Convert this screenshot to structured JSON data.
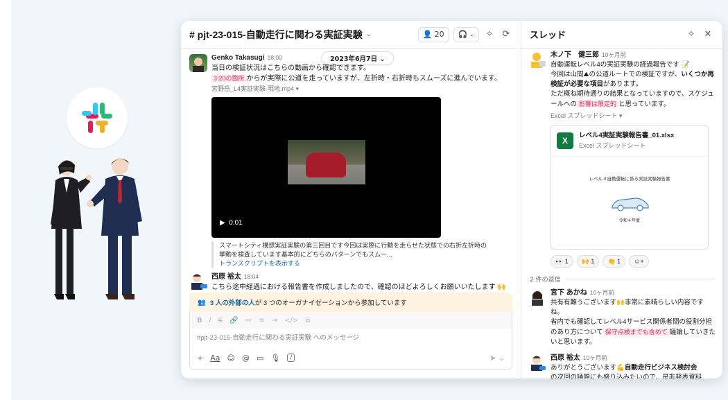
{
  "channel": {
    "title": "# pjt-23-015-自動走行に関わる実証実験",
    "member_count": "20",
    "date_pill": "2023年6月7日",
    "messages": [
      {
        "author": "Genko Takasugi",
        "time": "18:00",
        "line1": "当日の検証状況はこちらの動画から確認できます。",
        "timestamp_tag": "3:20の箇所",
        "line2": "からが実際に公道を走っていますが、左折時・右折時もスムーズに進んでいます。",
        "file_name": "宮野岳_L4実証実験-現地.mp4",
        "video_time": "0:01",
        "transcript": "スマートシティ構想実証実験の第三回目です今回は実際に行動を走らせた状態での右折左折時の挙動を検査しています基本的にどちらのパターンでもスムー...",
        "transcript_link": "トランスクリプトを表示する"
      },
      {
        "author": "西原 裕太",
        "time": "18:04",
        "text": "こちら途中経過における報告書を作成しましたので、確認のほどよろしくお願いいたします"
      }
    ],
    "external_notice_bold": "3 人の外部の人",
    "external_notice_rest": "が 3 つのオーガナイゼーションから参加しています",
    "composer_placeholder": "#pjt-23-015-自動走行に関わる実証実験 へのメッセージ",
    "format_buttons": [
      "B",
      "I",
      "S",
      "🔗",
      "≔",
      "≡",
      "⇥",
      "</>",
      "⧉"
    ],
    "tool_buttons": [
      "+",
      "Aa",
      "☺",
      "@",
      "▭",
      "🎙",
      "/"
    ]
  },
  "thread": {
    "title": "スレッド",
    "root": {
      "author": "木ノ下　健三郎",
      "time": "10ヶ月前",
      "line1": "自動運転レベル4の実証実験の経過報告です",
      "line2a": "今回は山間",
      "line2b": "の公道ルートでの検証ですが、",
      "line2bold": "いくつか再検証が必要な項目",
      "line2c": "があります。",
      "line3a": "ただ概ね期待通りの結果となっていますので、スケジュールへの",
      "tag": "影響は限定的",
      "line3b": "と思っています。",
      "file_type_label": "Excel スプレッドシート",
      "file_name": "レベル4実証実験報告書_01.xlsx",
      "file_sub": "Excel スプレッドシート",
      "doc_title": "レベル４自動運転に係る実証実験報告書",
      "doc_date": "令和４年度",
      "reactions": [
        "👀 1",
        "🙌 1",
        "👏 1",
        "☺+"
      ]
    },
    "reply_count": "2 件の返信",
    "replies": [
      {
        "author": "宮下 あかね",
        "time": "10ヶ月前",
        "line1": "共有有難うございます",
        "line1b": "非常に素晴らしい内容ですね。",
        "line2a": "省内でも確認してレベル4サービス関係者間の役割分担のあり方について",
        "tag": "保守点検までも含めて",
        "line2b": "議論していきたいと思います。"
      },
      {
        "author": "西原 裕太",
        "time": "10ヶ月前",
        "line1": "ありがとうございます",
        "bold": "自動走行ビジネス検討会",
        "line2": "の次回の議題にも盛り込みたいので、是非発表資料"
      }
    ]
  },
  "colors": {
    "accent_link": "#1264a3",
    "tag_bg": "#fde8ee",
    "tag_fg": "#d0345f",
    "excel": "#107c41",
    "notice_bg": "#fdf3e0"
  }
}
